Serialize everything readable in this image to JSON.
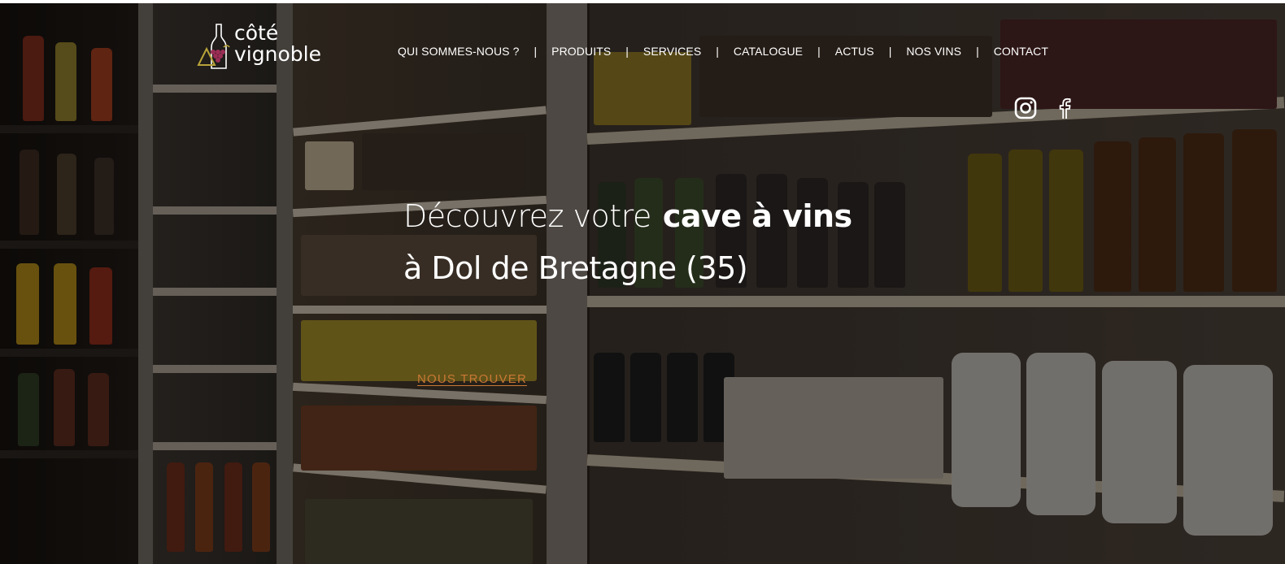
{
  "brand": {
    "name_line1": "côté",
    "name_line2": "vignoble"
  },
  "nav": {
    "items": [
      {
        "label": "QUI SOMMES-NOUS ?"
      },
      {
        "label": "PRODUITS"
      },
      {
        "label": "SERVICES"
      },
      {
        "label": "CATALOGUE"
      },
      {
        "label": "ACTUS"
      },
      {
        "label": "NOS VINS"
      },
      {
        "label": "CONTACT"
      }
    ],
    "separator": "|"
  },
  "social": {
    "instagram_icon": "instagram-icon",
    "facebook_icon": "facebook-icon"
  },
  "hero": {
    "headline_part1": "Découvrez votre",
    "headline_bold": "cave à vins",
    "headline_line2": "à Dol de Bretagne (35)",
    "cta_label": "NOUS TROUVER",
    "background": "wine-shop-shelves-photo"
  },
  "colors": {
    "accent": "#c97835",
    "text": "#ffffff",
    "grape": "#9b2d55",
    "leaf": "#b8a33a"
  }
}
